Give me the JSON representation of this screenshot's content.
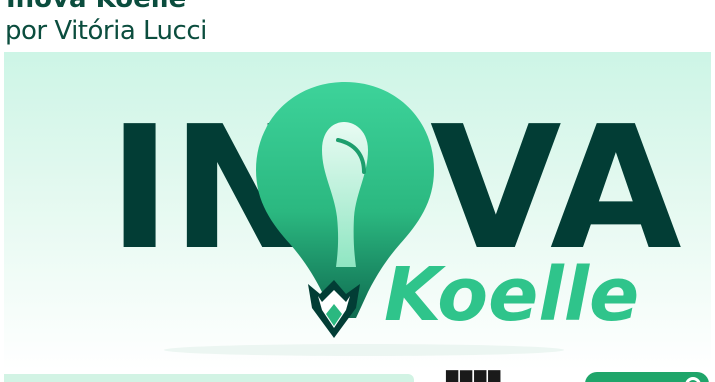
{
  "header": {
    "title": "Inova Koelle",
    "author": "por Vitória Lucci"
  },
  "banner": {
    "logo_left": "IN",
    "logo_right": "VA",
    "logo_sub": "Koelle",
    "colors": {
      "dark": "#023d35",
      "accent": "#35c98f",
      "background": "#d4f6e8"
    }
  },
  "footer": {
    "icon": "grid-icon"
  }
}
